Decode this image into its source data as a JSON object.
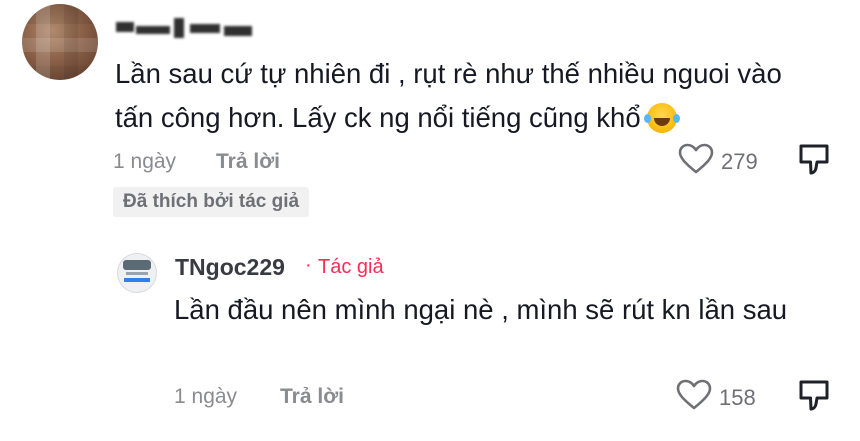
{
  "comment": {
    "username": "",
    "text": "Lần sau cứ tự nhiên đi , rụt rè như thế nhiều nguoi vào tấn công hơn. Lấy ck ng nổi tiếng cũng khổ",
    "emoji": "face-with-tears-of-joy",
    "time": "1 ngày",
    "reply_label": "Trả lời",
    "like_count": "279",
    "liked_by_author_label": "Đã thích bởi tác giả"
  },
  "reply": {
    "username": "TNgoc229",
    "dot": "·",
    "author_label": "Tác giả",
    "text": "Lần đầu nên mình ngại nè , mình sẽ rút kn lần sau",
    "time": "1 ngày",
    "reply_label": "Trả lời",
    "like_count": "158"
  },
  "colors": {
    "text": "#161823",
    "muted": "#8a8b91",
    "author_accent": "#fe2c55",
    "badge_bg": "#f1f1f2"
  },
  "icons": [
    "heart-outline-icon",
    "dislike-icon",
    "emoji-laugh-icon"
  ]
}
